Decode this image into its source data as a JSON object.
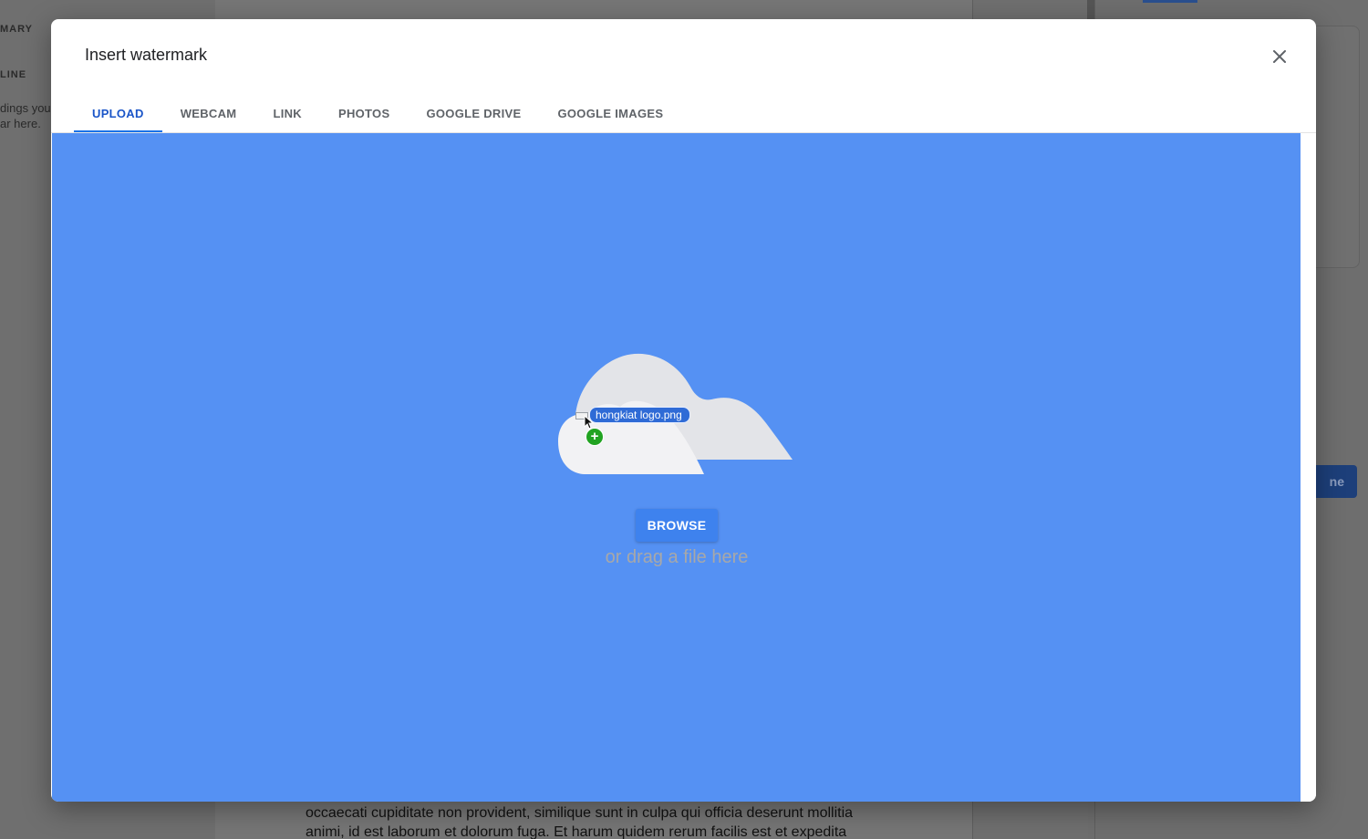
{
  "background": {
    "sidebar_labels": [
      "MARY",
      "LINE"
    ],
    "sidebar_text": [
      "dings you",
      "ar here."
    ],
    "done_button_label": "ne",
    "paragraph": "occaecati cupiditate non provident, similique sunt in culpa qui officia deserunt mollitia animi, id est laborum et dolorum fuga. Et harum quidem rerum facilis est et expedita"
  },
  "modal": {
    "title": "Insert watermark",
    "close_icon": "close-icon",
    "tabs": [
      {
        "label": "UPLOAD",
        "active": true
      },
      {
        "label": "WEBCAM",
        "active": false
      },
      {
        "label": "LINK",
        "active": false
      },
      {
        "label": "PHOTOS",
        "active": false
      },
      {
        "label": "GOOGLE DRIVE",
        "active": false
      },
      {
        "label": "GOOGLE IMAGES",
        "active": false
      }
    ],
    "upload": {
      "dragged_file": "hongkiat logo.png",
      "browse_label": "BROWSE",
      "drag_hint": "or drag a file here"
    }
  },
  "colors": {
    "accent": "#1a73e8",
    "dropzone": "#5591f3",
    "browse": "#3e82ee"
  }
}
